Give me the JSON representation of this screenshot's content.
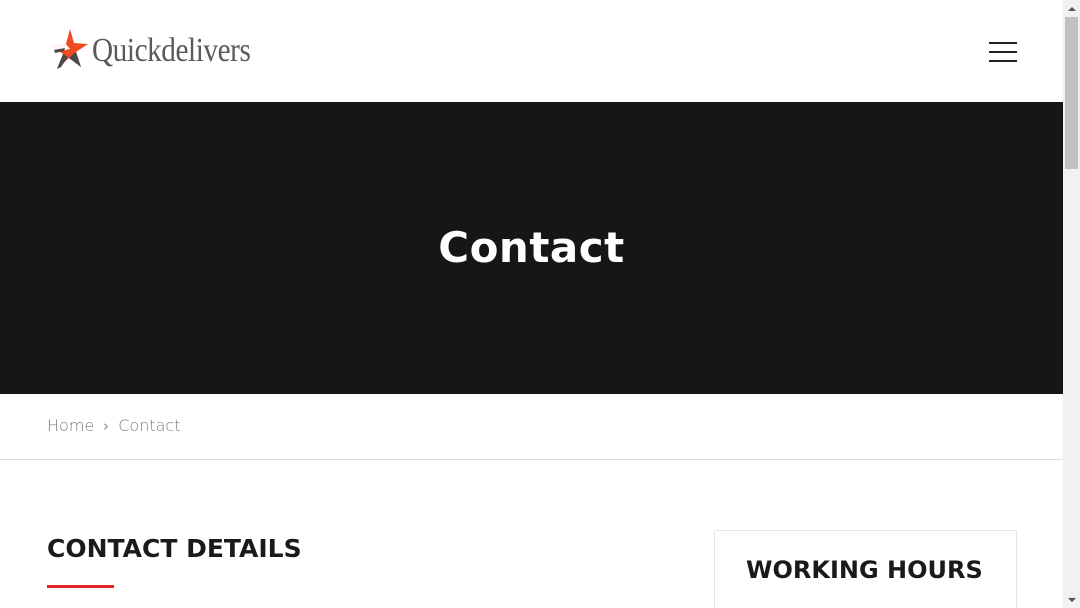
{
  "header": {
    "logo_text": "Quickdelivers",
    "menu_icon": "hamburger-menu-icon"
  },
  "hero": {
    "title": "Contact"
  },
  "breadcrumb": {
    "home": "Home",
    "separator": "›",
    "current": "Contact"
  },
  "main": {
    "contact_heading": "CONTACT DETAILS",
    "working_hours_heading": "WORKING HOURS"
  },
  "colors": {
    "hero_bg": "#161616",
    "accent": "#e02424",
    "logo_star_orange": "#ef4b23",
    "logo_star_dark": "#4a4a4a"
  }
}
